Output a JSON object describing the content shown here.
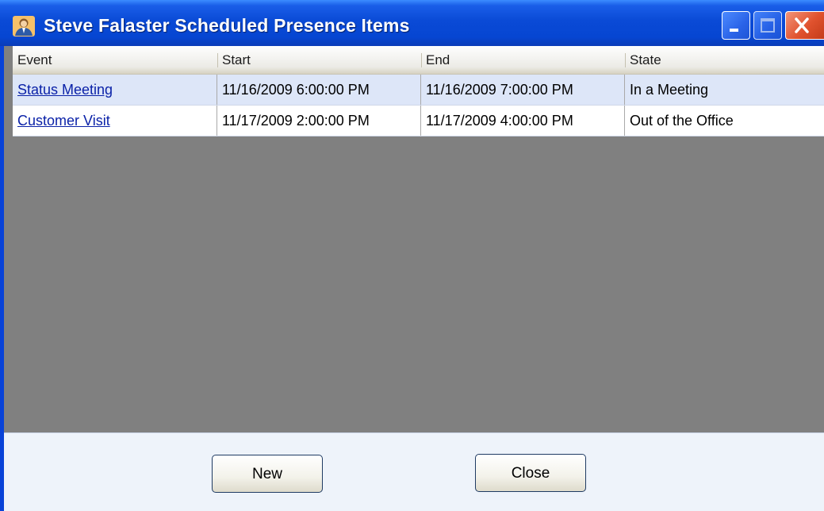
{
  "window": {
    "title": "Steve Falaster Scheduled Presence Items",
    "icon": "user-icon",
    "controls": [
      "minimize-icon",
      "maximize-icon",
      "close-icon"
    ]
  },
  "table": {
    "columns": [
      "Event",
      "Start",
      "End",
      "State"
    ],
    "rows": [
      {
        "event": "Status Meeting",
        "start": "11/16/2009 6:00:00 PM",
        "end": "11/16/2009 7:00:00 PM",
        "state": "In a Meeting",
        "selected": true
      },
      {
        "event": "Customer Visit",
        "start": "11/17/2009 2:00:00 PM",
        "end": "11/17/2009 4:00:00 PM",
        "state": "Out of the Office",
        "selected": false
      }
    ]
  },
  "buttons": {
    "new_label": "New",
    "close_label": "Close"
  },
  "colors": {
    "titlebar": "#0646d2",
    "link": "#0b22a8",
    "selected_row": "#dde6f8",
    "empty_area": "#808080",
    "close_button": "#e0522e"
  }
}
